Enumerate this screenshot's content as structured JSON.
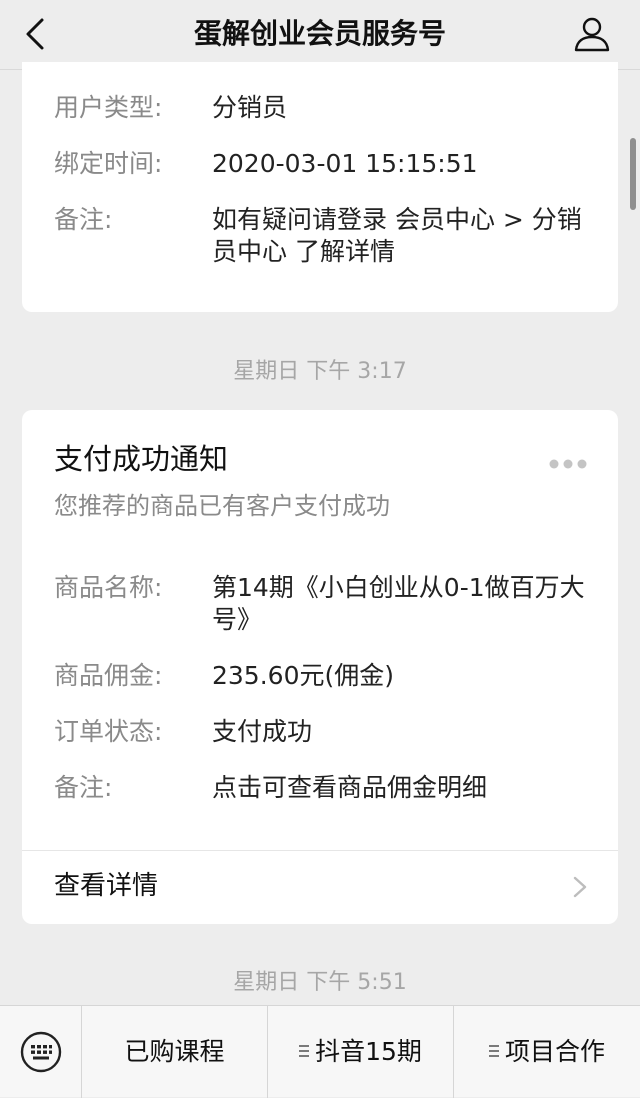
{
  "header": {
    "title": "蛋解创业会员服务号",
    "back_icon": "chevron-left-icon",
    "profile_icon": "person-icon"
  },
  "card1": {
    "rows": [
      {
        "label": "用户类型:",
        "value": "分销员"
      },
      {
        "label": "绑定时间:",
        "value": "2020-03-01 15:15:51"
      },
      {
        "label": "备注:",
        "value": "如有疑问请登录 会员中心 > 分销员中心 了解详情"
      }
    ]
  },
  "timestamps": [
    "星期日 下午 3:17",
    "星期日 下午 5:51"
  ],
  "card2": {
    "title": "支付成功通知",
    "subtitle": "您推荐的商品已有客户支付成功",
    "more_icon": "more-dots-icon",
    "rows": [
      {
        "label": "商品名称:",
        "value": "第14期《小白创业从0-1做百万大号》"
      },
      {
        "label": "商品佣金:",
        "value": "235.60元(佣金)"
      },
      {
        "label": "订单状态:",
        "value": "支付成功"
      },
      {
        "label": "备注:",
        "value": "点击可查看商品佣金明细"
      }
    ],
    "view_detail": "查看详情"
  },
  "bottom_menu": {
    "keyboard_icon": "keyboard-icon",
    "items": [
      "已购课程",
      "抖音15期",
      "项目合作"
    ]
  },
  "colors": {
    "background": "#ededed",
    "card": "#ffffff",
    "label_gray": "#8a8a8a"
  }
}
